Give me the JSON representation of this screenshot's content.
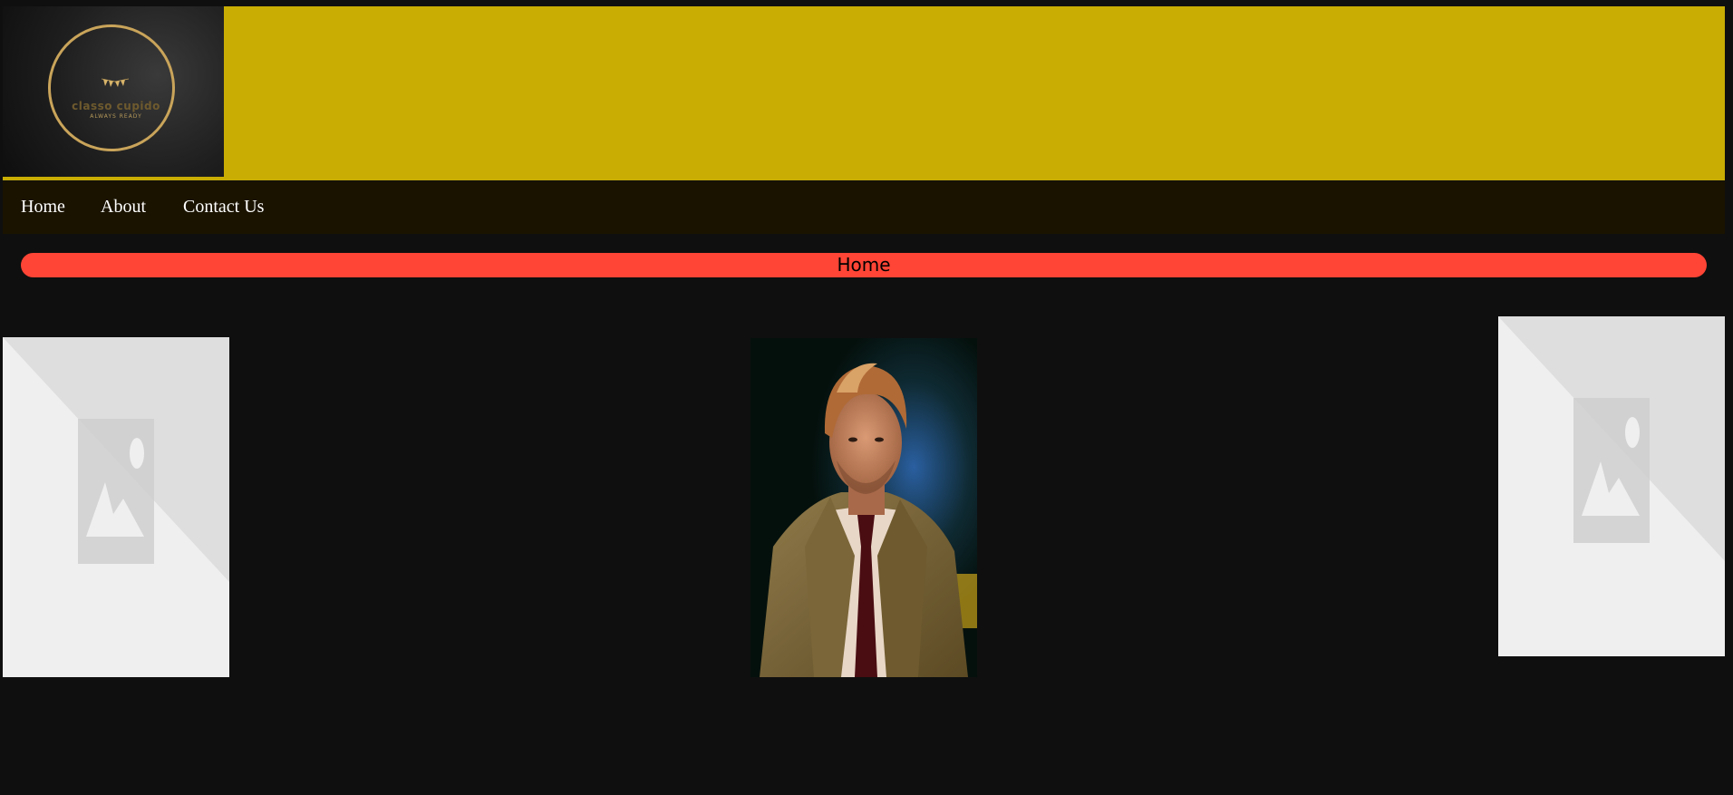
{
  "logo": {
    "name": "classo cupido",
    "tagline": "ALWAYS READY"
  },
  "nav": {
    "items": [
      {
        "label": "Home"
      },
      {
        "label": "About"
      },
      {
        "label": "Contact Us"
      }
    ]
  },
  "banner": {
    "label": "Home"
  },
  "colors": {
    "header_bg": "#c9ad03",
    "nav_bg": "#1a1300",
    "banner_bg": "#ff4535",
    "page_bg": "#0f0f0f"
  },
  "gallery": {
    "left_image": "image-placeholder-icon",
    "center_image": "man-in-trench-coat-photo",
    "right_image": "image-placeholder-icon"
  }
}
